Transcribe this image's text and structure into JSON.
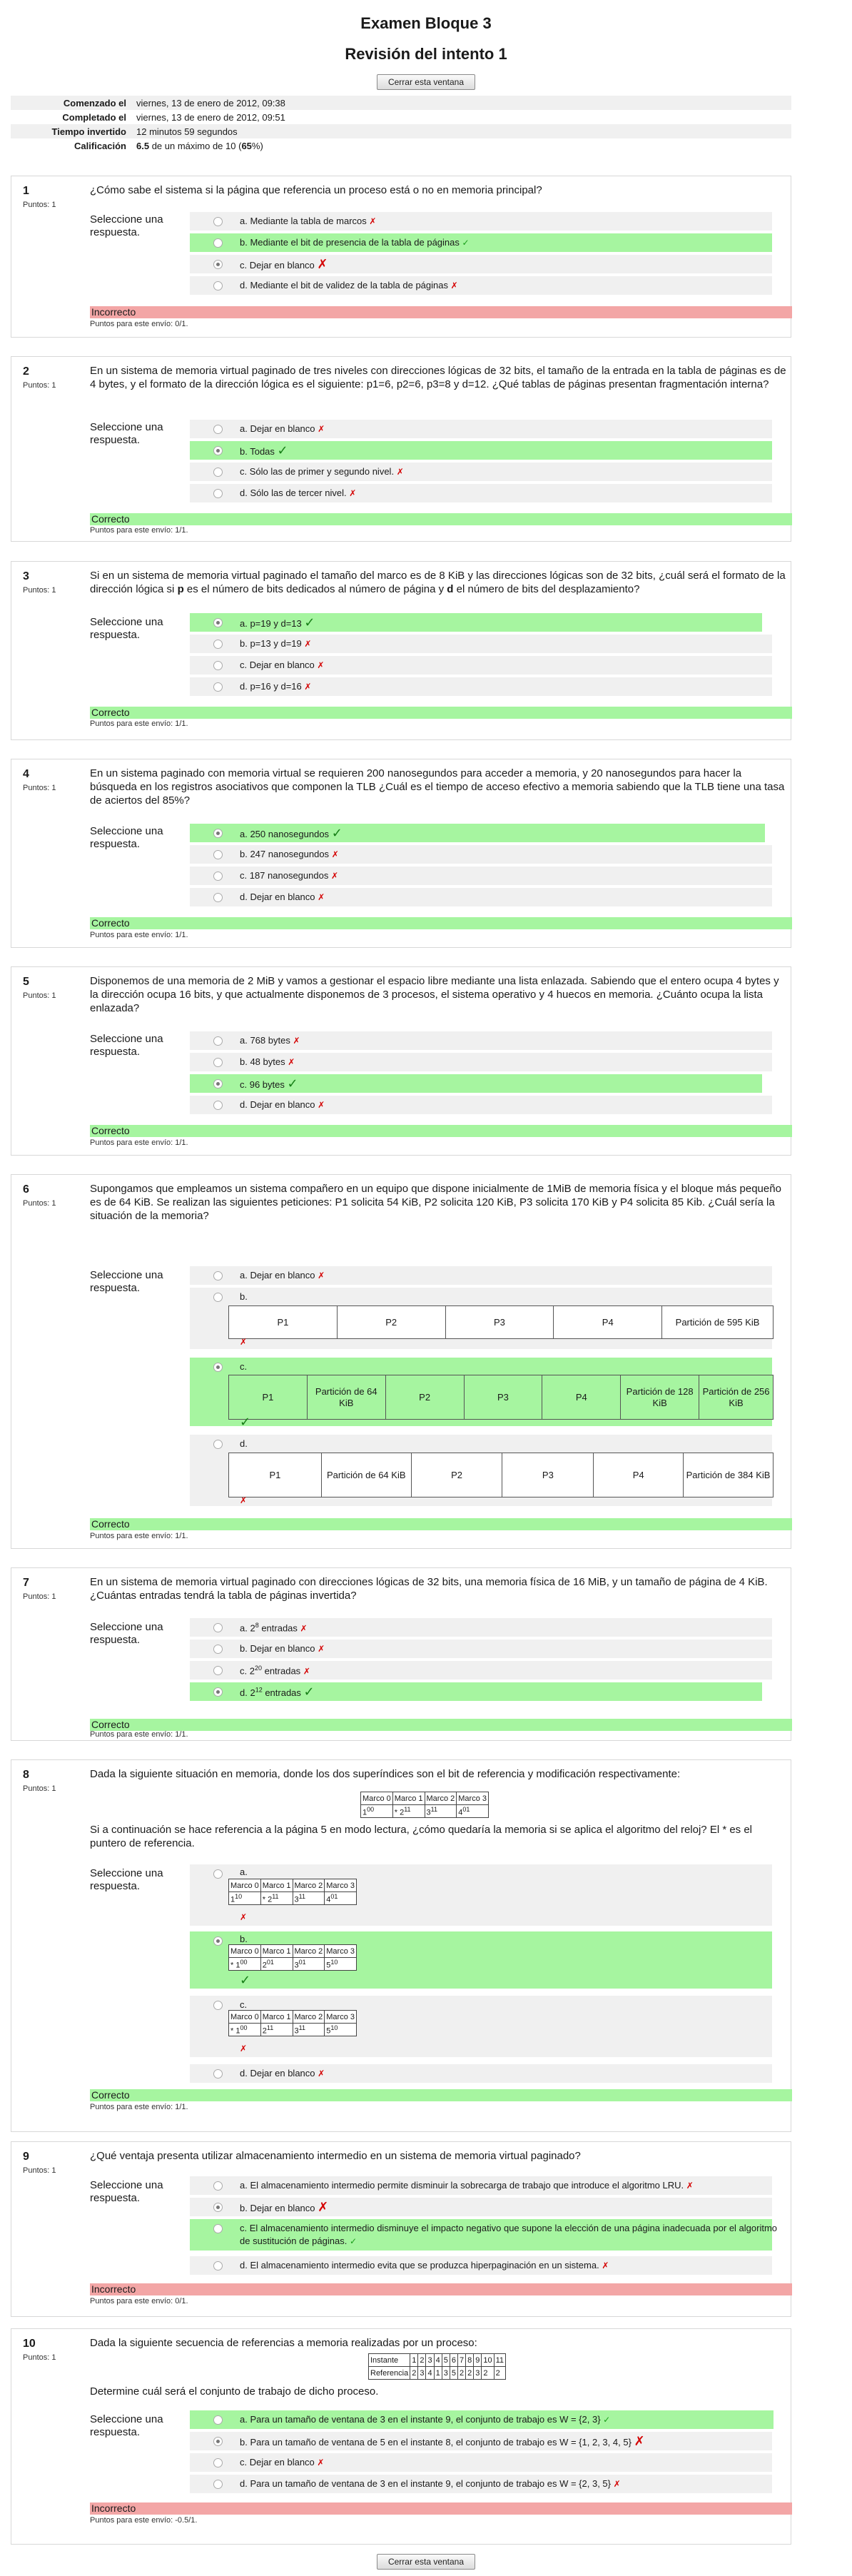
{
  "header": {
    "title": "Examen Bloque 3",
    "subtitle": "Revisión del intento 1",
    "close_button": "Cerrar esta ventana"
  },
  "summary": [
    {
      "k": "Comenzado el",
      "v": "viernes, 13 de enero de 2012, 09:38"
    },
    {
      "k": "Completado el",
      "v": "viernes, 13 de enero de 2012, 09:51"
    },
    {
      "k": "Tiempo invertido",
      "v": "12 minutos 59 segundos"
    },
    {
      "k": "Calificación",
      "v_bold": "6.5",
      "v_mid": " de un máximo de 10 (",
      "v_pct": "65",
      "v_end": "%)"
    }
  ],
  "common": {
    "grade_label": "Puntos: 1",
    "prompt": "Seleccione una respuesta.",
    "incorrect": "Incorrecto",
    "correct": "Correcto"
  },
  "questions": [
    {
      "num": "1",
      "text": "¿Cómo sabe el sistema si la página que referencia un proceso está o no en memoria principal?",
      "options": [
        "a. Mediante la tabla de marcos",
        "b. Mediante el bit de presencia de la tabla de páginas",
        "c. Dejar en blanco",
        "d. Mediante el bit de validez de la tabla de páginas"
      ],
      "points": "Puntos para este envío: 0/1."
    },
    {
      "num": "2",
      "text": "En un sistema de memoria virtual paginado de tres niveles con direcciones lógicas de 32 bits, el tamaño de la entrada en la tabla de páginas es de 4 bytes, y el formato de la dirección lógica es el siguiente: p1=6, p2=6, p3=8 y d=12. ¿Qué tablas de páginas presentan fragmentación interna?",
      "options": [
        "a. Dejar en blanco",
        "b. Todas",
        "c. Sólo las de primer y segundo nivel.",
        "d. Sólo las de tercer nivel."
      ],
      "points": "Puntos para este envío: 1/1."
    },
    {
      "num": "3",
      "text_parts": [
        "Si en un sistema de memoria virtual paginado el tamaño del marco es de 8 KiB y las direcciones lógicas son de 32 bits, ¿cuál será el formato de la dirección lógica si ",
        "p",
        " es el número de bits dedicados al número de página y ",
        "d",
        " el número de bits del desplazamiento?"
      ],
      "options": [
        "a. p=19 y d=13",
        "b. p=13 y d=19",
        "c. Dejar en blanco",
        "d. p=16 y d=16"
      ],
      "points": "Puntos para este envío: 1/1."
    },
    {
      "num": "4",
      "text": "En un sistema paginado con memoria virtual se requieren 200 nanosegundos para acceder a memoria, y 20 nanosegundos para hacer la búsqueda en los registros asociativos que componen la TLB ¿Cuál es el tiempo de acceso efectivo a memoria sabiendo que la TLB tiene una tasa de aciertos del 85%?",
      "options": [
        "a. 250 nanosegundos",
        "b. 247 nanosegundos",
        "c. 187 nanosegundos",
        "d. Dejar en blanco"
      ],
      "points": "Puntos para este envío: 1/1."
    },
    {
      "num": "5",
      "text": "Disponemos de una memoria de 2 MiB y vamos a gestionar el espacio libre mediante una lista enlazada. Sabiendo que el entero ocupa 4 bytes y la dirección ocupa 16 bits, y que actualmente disponemos de 3 procesos, el sistema operativo y 4 huecos en memoria. ¿Cuánto ocupa la lista enlazada?",
      "options": [
        "a. 768 bytes",
        "b. 48 bytes",
        "c. 96 bytes",
        "d. Dejar en blanco"
      ],
      "points": "Puntos para este envío: 1/1."
    },
    {
      "num": "6",
      "text": "Supongamos que empleamos un sistema compañero en un equipo que dispone inicialmente de 1MiB de memoria física y el bloque más pequeño es de 64 KiB. Se realizan las siguientes peticiones: P1 solicita 54 KiB, P2 solicita 120 KiB, P3 solicita 170 KiB y P4 solicita 85 Kib. ¿Cuál sería la situación de la memoria?",
      "opt_a": "a. Dejar en blanco",
      "opt_b": "b.",
      "opt_c": "c.",
      "opt_d": "d.",
      "b_cells": [
        "P1",
        "P2",
        "P3",
        "P4",
        "Partición de 595 KiB"
      ],
      "c_cells": [
        "P1",
        "Partición de 64 KiB",
        "P2",
        "P3",
        "P4",
        "Partición de 128 KiB",
        "Partición de 256 KiB"
      ],
      "d_cells": [
        "P1",
        "Partición de 64 KiB",
        "P2",
        "P3",
        "P4",
        "Partición de 384 KiB"
      ],
      "points": "Puntos para este envío: 1/1."
    },
    {
      "num": "7",
      "text": "En un sistema de memoria virtual paginado con direcciones lógicas de 32 bits, una memoria física de 16 MiB, y un tamaño de página de 4 KiB. ¿Cuántas entradas tendrá la tabla de páginas invertida?",
      "opts": [
        {
          "pre": "a. 2",
          "sup": "8",
          "post": " entradas"
        },
        {
          "pre": "b. Dejar en blanco",
          "sup": "",
          "post": ""
        },
        {
          "pre": "c. 2",
          "sup": "20",
          "post": " entradas"
        },
        {
          "pre": "d. 2",
          "sup": "12",
          "post": " entradas"
        }
      ],
      "points": "Puntos para este envío: 1/1."
    },
    {
      "num": "8",
      "text1": "Dada la siguiente situación en memoria, donde los dos superíndices son el bit de referencia y modificación respectivamente:",
      "text2": "Si a continuación se hace referencia a la página 5 en modo lectura, ¿cómo quedaría la memoria si se aplica el algoritmo del reloj? El * es el puntero de referencia.",
      "frames": [
        "Marco 0",
        "Marco 1",
        "Marco 2",
        "Marco 3"
      ],
      "state": [
        [
          "",
          "1",
          "00"
        ],
        [
          "* 2",
          "",
          "11"
        ],
        [
          "3",
          "",
          "11"
        ],
        [
          "4",
          "",
          "01"
        ]
      ],
      "opt_a": "a.",
      "opt_b": "b.",
      "opt_c": "c.",
      "opt_d": "d. Dejar en blanco",
      "a_row": [
        [
          "1",
          "10"
        ],
        [
          "* 2",
          "11"
        ],
        [
          "3",
          "11"
        ],
        [
          "4",
          "01"
        ]
      ],
      "b_row": [
        [
          "* 1",
          "00"
        ],
        [
          "2",
          "01"
        ],
        [
          "3",
          "01"
        ],
        [
          "5",
          "10"
        ]
      ],
      "c_row": [
        [
          "* 1",
          "00"
        ],
        [
          "2",
          "11"
        ],
        [
          "3",
          "11"
        ],
        [
          "5",
          "10"
        ]
      ],
      "points": "Puntos para este envío: 1/1."
    },
    {
      "num": "9",
      "text": "¿Qué ventaja presenta utilizar almacenamiento intermedio en un sistema de memoria virtual paginado?",
      "options": [
        "a. El almacenamiento intermedio permite disminuir la sobrecarga de trabajo que introduce el algoritmo LRU.",
        "b. Dejar en blanco",
        "c. El almacenamiento intermedio disminuye el impacto negativo que supone la elección de una página inadecuada por el algoritmo de sustitución de páginas.",
        "d. El almacenamiento intermedio evita que se produzca hiperpaginación en un sistema."
      ],
      "points": "Puntos para este envío: 0/1."
    },
    {
      "num": "10",
      "text1": "Dada la siguiente secuencia de referencias a memoria realizadas por un proceso:",
      "text2": "Determine cuál será el conjunto de trabajo de dicho proceso.",
      "ref_table": {
        "row1_label": "Instante",
        "row1": [
          "1",
          "2",
          "3",
          "4",
          "5",
          "6",
          "7",
          "8",
          "9",
          "10",
          "11"
        ],
        "row2_label": "Referencia",
        "row2": [
          "2",
          "3",
          "4",
          "1",
          "3",
          "5",
          "2",
          "2",
          "3",
          "2",
          "2"
        ]
      },
      "options": [
        "a. Para un tamaño de ventana de 3 en el instante 9, el conjunto de trabajo es W = {2, 3}",
        "b. Para un tamaño de ventana de 5 en el instante 8, el conjunto de trabajo es W = {1, 2, 3, 4, 5}",
        "c. Dejar en blanco",
        "d. Para un tamaño de ventana de 3 en el instante 9, el conjunto de trabajo es W = {2, 3, 5}"
      ],
      "points": "Puntos para este envío: -0.5/1."
    }
  ],
  "marks": {
    "cross": "✗",
    "check": "✓"
  },
  "colors": {
    "correct_bg": "#a6f5a0",
    "incorrect_bg": "#f3a6a6",
    "option_bg": "#f0f0f0",
    "cross": "#d40000",
    "check": "#1a9e1a"
  }
}
